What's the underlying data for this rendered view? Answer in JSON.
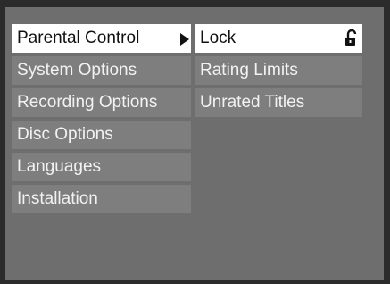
{
  "menu": {
    "left": [
      {
        "label": "Parental Control",
        "selected": true
      },
      {
        "label": "System Options"
      },
      {
        "label": "Recording Options"
      },
      {
        "label": "Disc Options"
      },
      {
        "label": "Languages"
      },
      {
        "label": "Installation"
      }
    ],
    "right": [
      {
        "label": "Lock",
        "selected": true,
        "icon": "lock-icon"
      },
      {
        "label": "Rating Limits"
      },
      {
        "label": "Unrated Titles"
      }
    ]
  },
  "icons": {
    "submenu_arrow": "arrow-right-icon",
    "lock": "lock-icon"
  },
  "colors": {
    "panel": "#6e6e6e",
    "item": "#7e7e7e",
    "selected": "#ffffff",
    "text": "#f2f2f2",
    "selected_text": "#111111"
  }
}
